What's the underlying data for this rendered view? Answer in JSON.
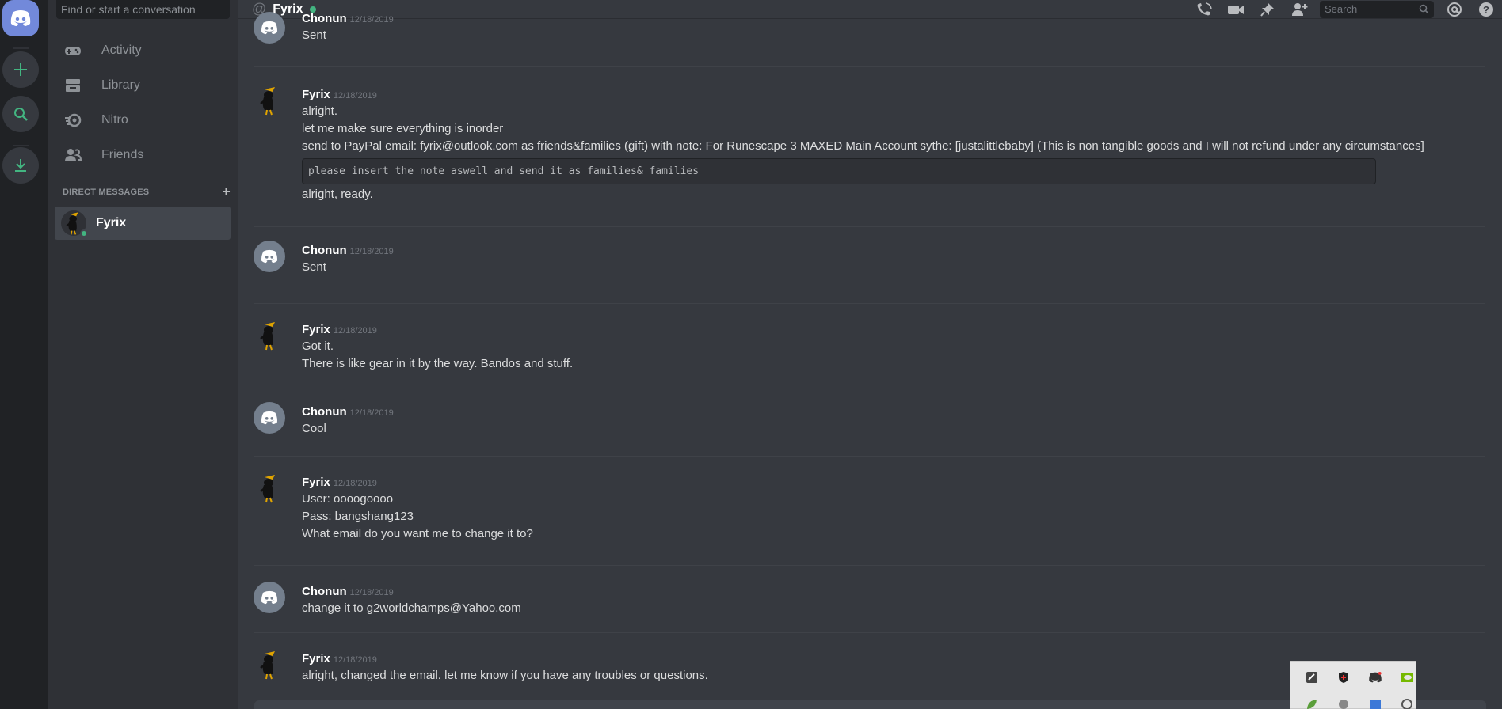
{
  "sidebar": {
    "search_placeholder": "Find or start a conversation",
    "nav": [
      {
        "label": "Activity",
        "icon": "gamepad-icon"
      },
      {
        "label": "Library",
        "icon": "library-icon"
      },
      {
        "label": "Nitro",
        "icon": "nitro-icon"
      },
      {
        "label": "Friends",
        "icon": "friends-icon"
      }
    ],
    "dm_header": "DIRECT MESSAGES",
    "dm_add": "+",
    "dm_items": [
      {
        "name": "Fyrix",
        "status": "online"
      }
    ]
  },
  "header": {
    "channel": "Fyrix",
    "search_placeholder": "Search"
  },
  "messages": [
    {
      "user": "Chonun",
      "time": "12/18/2019",
      "lines": [
        "Sent"
      ]
    },
    {
      "user": "Fyrix",
      "time": "12/18/2019",
      "lines": [
        "alright.",
        "let me make sure everything is inorder",
        "send to PayPal email: fyrix@outlook.com as friends&families (gift) with note: For  Runescape 3 MAXED Main Account  sythe: [justalittlebaby] (This is non tangible goods and I will not refund under any circumstances]"
      ],
      "code": "please insert the note aswell and send it as families& families",
      "after": "alright, ready."
    },
    {
      "user": "Chonun",
      "time": "12/18/2019",
      "lines": [
        "Sent"
      ]
    },
    {
      "user": "Fyrix",
      "time": "12/18/2019",
      "lines": [
        "Got it.",
        "There is like gear in it by the way. Bandos and stuff."
      ]
    },
    {
      "user": "Chonun",
      "time": "12/18/2019",
      "lines": [
        "Cool"
      ]
    },
    {
      "user": "Fyrix",
      "time": "12/18/2019",
      "lines": [
        "User: oooogoooo",
        "Pass: bangshang123",
        "What email do you want me to change it to?"
      ]
    },
    {
      "user": "Chonun",
      "time": "12/18/2019",
      "lines": [
        "change it to g2worldchamps@Yahoo.com"
      ]
    },
    {
      "user": "Fyrix",
      "time": "12/18/2019",
      "lines": [
        "alright, changed the email. let me know if you have any troubles or questions."
      ]
    }
  ],
  "colors": {
    "blurple": "#7289da",
    "online": "#43b581",
    "accent_green": "#43b581"
  }
}
